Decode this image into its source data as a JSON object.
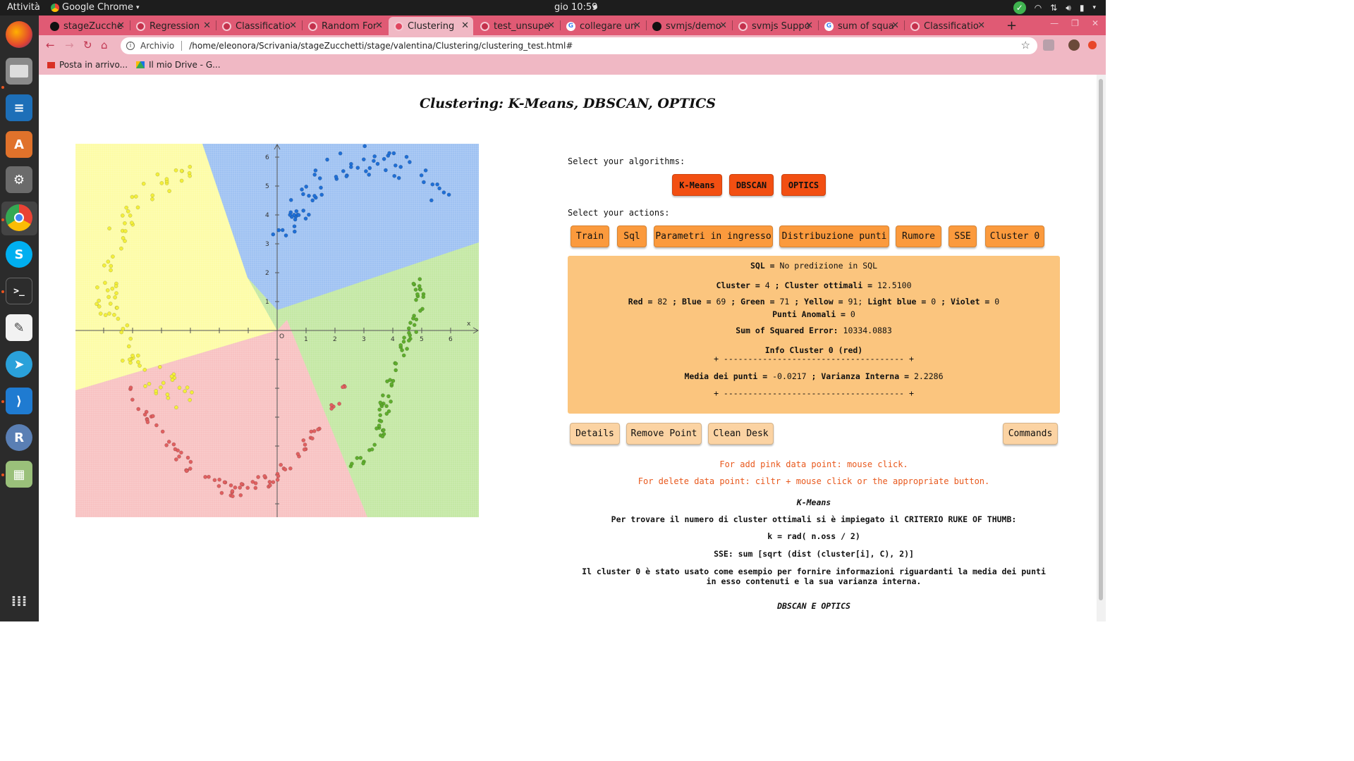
{
  "system": {
    "activities": "Attività",
    "app_name": "Google Chrome",
    "clock": "gio 10:59"
  },
  "tabs": [
    {
      "title": "stageZucche",
      "icon": "github-icon"
    },
    {
      "title": "Regression",
      "icon": "page-icon"
    },
    {
      "title": "Classificatio",
      "icon": "page-icon"
    },
    {
      "title": "Random For",
      "icon": "page-icon"
    },
    {
      "title": "Clustering",
      "icon": "page-icon",
      "active": true
    },
    {
      "title": "test_unsupe",
      "icon": "page-icon"
    },
    {
      "title": "collegare un",
      "icon": "google-icon"
    },
    {
      "title": "svmjs/demo",
      "icon": "github-icon"
    },
    {
      "title": "svmjs Suppo",
      "icon": "page-icon"
    },
    {
      "title": "sum of squa",
      "icon": "google-icon"
    },
    {
      "title": "Classificatio",
      "icon": "page-icon"
    }
  ],
  "address": {
    "security_label": "Archivio",
    "url": "/home/eleonora/Scrivania/stageZucchetti/stage/valentina/Clustering/clustering_test.html#"
  },
  "bookmarks": [
    {
      "label": "Posta in arrivo...",
      "icon": "gmail-icon"
    },
    {
      "label": "Il mio Drive - G...",
      "icon": "drive-icon"
    }
  ],
  "page": {
    "title": "Clustering: K-Means, DBSCAN, OPTICS",
    "select_algorithms": "Select your algorithms:",
    "algorithms": [
      "K-Means",
      "DBSCAN",
      "OPTICS"
    ],
    "select_actions": "Select your actions:",
    "actions": [
      "Train",
      "Sql",
      "Parametri in ingresso",
      "Distribuzione punti",
      "Rumore",
      "SSE",
      "Cluster 0"
    ],
    "info": {
      "sql_key": "SQL =",
      "sql_val": "No predizione in SQL",
      "cluster_key": "Cluster =",
      "cluster_val": "4",
      "ottimali_key": "; Cluster ottimali =",
      "ottimali_val": "12.5100",
      "red_key": "Red =",
      "red_val": "82",
      "blue_key": "; Blue =",
      "blue_val": "69",
      "green_key": "; Green =",
      "green_val": "71",
      "yellow_key": "; Yellow =",
      "yellow_val": "91;",
      "lightblue_key": "Light blue =",
      "lightblue_val": "0",
      "violet_key": "; Violet =",
      "violet_val": "0",
      "anomali_key": "Punti Anomali =",
      "anomali_val": "0",
      "sse_key": "Sum of Squared Error:",
      "sse_val": "10334.0883",
      "info_cluster": "Info Cluster 0 (red)",
      "divider": "+ ------------------------------------- +",
      "media_key": "Media dei punti =",
      "media_val": "-0.0217",
      "varianza_key": "; Varianza Interna =",
      "varianza_val": "2.2286"
    },
    "bottom_buttons": [
      "Details",
      "Remove Point",
      "Clean Desk"
    ],
    "commands_button": "Commands",
    "note_add": "For add pink data point: mouse click.",
    "note_delete": "For delete data point: ciltr + mouse click or the appropriate button.",
    "kmeans_title": "K-Means",
    "kmeans_line1": "Per trovare il numero di cluster ottimali si è impiegato il CRITERIO RUKE OF THUMB:",
    "kmeans_formula": "k = rad( n.oss / 2)",
    "sse_formula": "SSE: sum [sqrt (dist (cluster[i], C), 2)]",
    "cluster0_note": "Il cluster 0 è stato usato come esempio per fornire informazioni riguardanti la media dei punti in esso contenuti e la sua varianza interna.",
    "dbscan_title": "DBSCAN E OPTICS"
  },
  "plot": {
    "x_label": "x",
    "x_ticks": [
      "1",
      "2",
      "3",
      "4",
      "5",
      "6"
    ],
    "y_ticks": [
      "1",
      "2",
      "3",
      "4",
      "5",
      "6"
    ],
    "origin": "O",
    "colors": {
      "yellow_region": "#fdfca6",
      "blue_region": "#9fc2f2",
      "green_region": "#c4e8a4",
      "red_region": "#f8c2c2",
      "yellow_point": "#f3ef3a",
      "blue_point": "#1f6fd6",
      "green_point": "#5fad2d",
      "red_point": "#e06060"
    }
  }
}
